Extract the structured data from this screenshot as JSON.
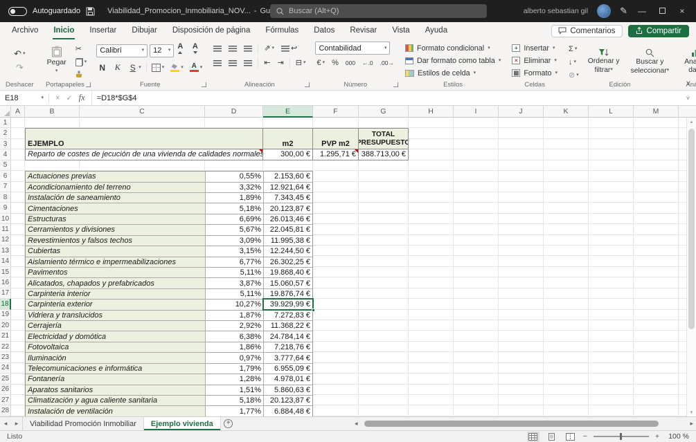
{
  "colors": {
    "accent": "#217346",
    "selection": "#1e7145",
    "cell_green": "#ebf1de"
  },
  "titlebar": {
    "autosave_label": "Autoguardado",
    "filename": "Viabilidad_Promocion_Inmobiliaria_NOV...",
    "saved_status": "Guardado",
    "search_placeholder": "Buscar (Alt+Q)",
    "user_name": "alberto sebastian gil"
  },
  "menu": {
    "tabs": [
      "Archivo",
      "Inicio",
      "Insertar",
      "Dibujar",
      "Disposición de página",
      "Fórmulas",
      "Datos",
      "Revisar",
      "Vista",
      "Ayuda"
    ],
    "active_tab": "Inicio",
    "comments_label": "Comentarios",
    "share_label": "Compartir"
  },
  "ribbon": {
    "groups": [
      "Deshacer",
      "Portapapeles",
      "Fuente",
      "Alineación",
      "Número",
      "Estilos",
      "Celdas",
      "Edición",
      "Análisis"
    ],
    "paste_label": "Pegar",
    "font_name": "Calibri",
    "font_size": "12",
    "bold_label": "N",
    "italic_label": "K",
    "underline_label": "S",
    "number_format": "Contabilidad",
    "percent_label": "%",
    "thousands_label": "000",
    "styles_items": [
      "Formato condicional",
      "Dar formato como tabla",
      "Estilos de celda"
    ],
    "cells_items": [
      "Insertar",
      "Eliminar",
      "Formato"
    ],
    "sort_filter": [
      "Ordenar y",
      "filtrar"
    ],
    "find_select": [
      "Buscar y",
      "seleccionar"
    ],
    "analyze": [
      "Analizar",
      "datos"
    ]
  },
  "icons": {
    "dropdown": "▾",
    "undo": "↶",
    "redo": "↷",
    "cut": "✂",
    "sum": "Σ",
    "fill_down": "↓",
    "clear": "⊘",
    "currency": "€",
    "increase_decimal": "←.0",
    "decrease_decimal": ".00→",
    "orientation": "⇗",
    "wrap": "↩",
    "indent_dec": "⇤",
    "indent_inc": "⇥",
    "merge": "⊟",
    "close": "×",
    "minimize": "—",
    "pen": "✎",
    "nav_left": "◂",
    "nav_right": "▸",
    "add_sheet": "+",
    "zoom_out": "−",
    "zoom_in": "+",
    "scroll_up": "▴",
    "scroll_down": "▾"
  },
  "formula_bar": {
    "cell_ref": "E18",
    "cancel": "×",
    "enter": "✓",
    "fx_label": "fx",
    "formula": "=D18*$G$4"
  },
  "grid": {
    "columns": [
      "A",
      "B",
      "C",
      "D",
      "E",
      "F",
      "G",
      "H",
      "I",
      "J",
      "K",
      "L",
      "M"
    ],
    "rows_visible": 28,
    "active_cell": {
      "col": "E",
      "row": 18
    },
    "header": {
      "ejemplo": "EJEMPLO",
      "m2": "m2",
      "pvp_m2": "PVP m2",
      "total": "TOTAL PRESUPUESTO",
      "description": "Reparto de costes de jecución de una vivienda de calidades normales.",
      "m2_value": "300,00 €",
      "pvp_value": "1.295,71 €",
      "total_value": "388.713,00 €"
    },
    "items": [
      {
        "row": 6,
        "name": "Actuaciones previas",
        "pct": "0,55%",
        "amount": "2.153,60 €"
      },
      {
        "row": 7,
        "name": "Acondicionamiento del terreno",
        "pct": "3,32%",
        "amount": "12.921,64 €"
      },
      {
        "row": 8,
        "name": "Instalación de saneamiento",
        "pct": "1,89%",
        "amount": "7.343,45 €"
      },
      {
        "row": 9,
        "name": "Cimentaciones",
        "pct": "5,18%",
        "amount": "20.123,87 €"
      },
      {
        "row": 10,
        "name": "Estructuras",
        "pct": "6,69%",
        "amount": "26.013,46 €"
      },
      {
        "row": 11,
        "name": "Cerramientos y divisiones",
        "pct": "5,67%",
        "amount": "22.045,81 €"
      },
      {
        "row": 12,
        "name": "Revestimientos y falsos techos",
        "pct": "3,09%",
        "amount": "11.995,38 €"
      },
      {
        "row": 13,
        "name": "Cubiertas",
        "pct": "3,15%",
        "amount": "12.244,50 €"
      },
      {
        "row": 14,
        "name": "Aislamiento térmico e impermeabilizaciones",
        "pct": "6,77%",
        "amount": "26.302,25 €"
      },
      {
        "row": 15,
        "name": "Pavimentos",
        "pct": "5,11%",
        "amount": "19.868,40 €"
      },
      {
        "row": 16,
        "name": "Alicatados, chapados y prefabricados",
        "pct": "3,87%",
        "amount": "15.060,57 €"
      },
      {
        "row": 17,
        "name": "Carpinteria interior",
        "pct": "5,11%",
        "amount": "19.876,74 €"
      },
      {
        "row": 18,
        "name": "Carpinteria exterior",
        "pct": "10,27%",
        "amount": "39.929,99 €"
      },
      {
        "row": 19,
        "name": "Vidriera y translucidos",
        "pct": "1,87%",
        "amount": "7.272,83 €"
      },
      {
        "row": 20,
        "name": "Cerrajería",
        "pct": "2,92%",
        "amount": "11.368,22 €"
      },
      {
        "row": 21,
        "name": "Electricidad y domótica",
        "pct": "6,38%",
        "amount": "24.784,14 €"
      },
      {
        "row": 22,
        "name": "Fotovoltaica",
        "pct": "1,86%",
        "amount": "7.218,76 €"
      },
      {
        "row": 23,
        "name": "Iluminación",
        "pct": "0,97%",
        "amount": "3.777,64 €"
      },
      {
        "row": 24,
        "name": "Telecomunicaciones e informática",
        "pct": "1,79%",
        "amount": "6.955,09 €"
      },
      {
        "row": 25,
        "name": "Fontanería",
        "pct": "1,28%",
        "amount": "4.978,01 €"
      },
      {
        "row": 26,
        "name": "Aparatos sanitarios",
        "pct": "1,51%",
        "amount": "5.860,63 €"
      },
      {
        "row": 27,
        "name": "Climatización y agua caliente sanitaria",
        "pct": "5,18%",
        "amount": "20.123,87 €"
      },
      {
        "row": 28,
        "name": "Instalación de ventilación",
        "pct": "1,77%",
        "amount": "6.884,48 €"
      }
    ]
  },
  "sheet_bar": {
    "tabs": [
      "Viabilidad Promoción Inmobiliar",
      "Ejemplo vivienda"
    ],
    "active_tab": "Ejemplo vivienda"
  },
  "status_bar": {
    "status": "Listo",
    "zoom": "100 %"
  }
}
